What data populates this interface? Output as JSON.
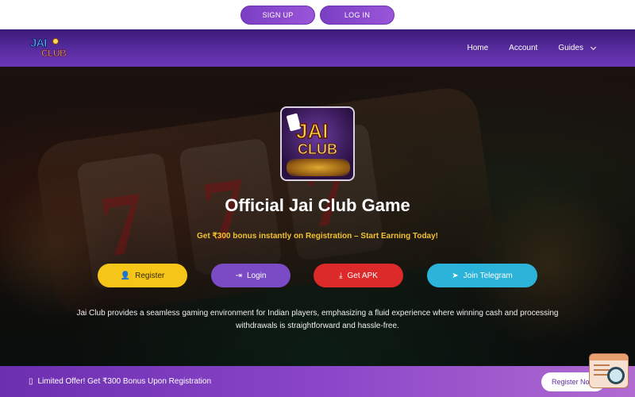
{
  "authbar": {
    "signup_label": "SIGN UP",
    "login_label": "LOG IN"
  },
  "nav": {
    "logo_top": "JAI",
    "logo_bottom": "CLUB",
    "items": [
      {
        "label": "Home"
      },
      {
        "label": "Account"
      },
      {
        "label": "Guides"
      }
    ]
  },
  "hero": {
    "game_logo_top": "JAI",
    "game_logo_bottom": "CLUB",
    "title": "Official Jai Club Game",
    "subtitle": "Get ₹300 bonus instantly on Registration – Start Earning Today!",
    "buttons": [
      {
        "label": "Register",
        "icon": "user-plus-icon"
      },
      {
        "label": "Login",
        "icon": "login-icon"
      },
      {
        "label": "Get APK",
        "icon": "download-icon"
      },
      {
        "label": "Join Telegram",
        "icon": "telegram-icon"
      }
    ],
    "description": "Jai Club provides a seamless gaming environment for Indian players, emphasizing a fluid experience where winning cash and processing withdrawals is straightforward and hassle-free."
  },
  "promo": {
    "icon": "▯",
    "text": "Limited Offer! Get ₹300 Bonus Upon Registration",
    "button_label": "Register Now"
  },
  "colors": {
    "nav_gradient": "#5b2ea3",
    "register": "#f5c518",
    "login": "#7a4bc4",
    "apk": "#dc2a2a",
    "telegram": "#2bb3d9",
    "subtitle": "#f2c230"
  }
}
